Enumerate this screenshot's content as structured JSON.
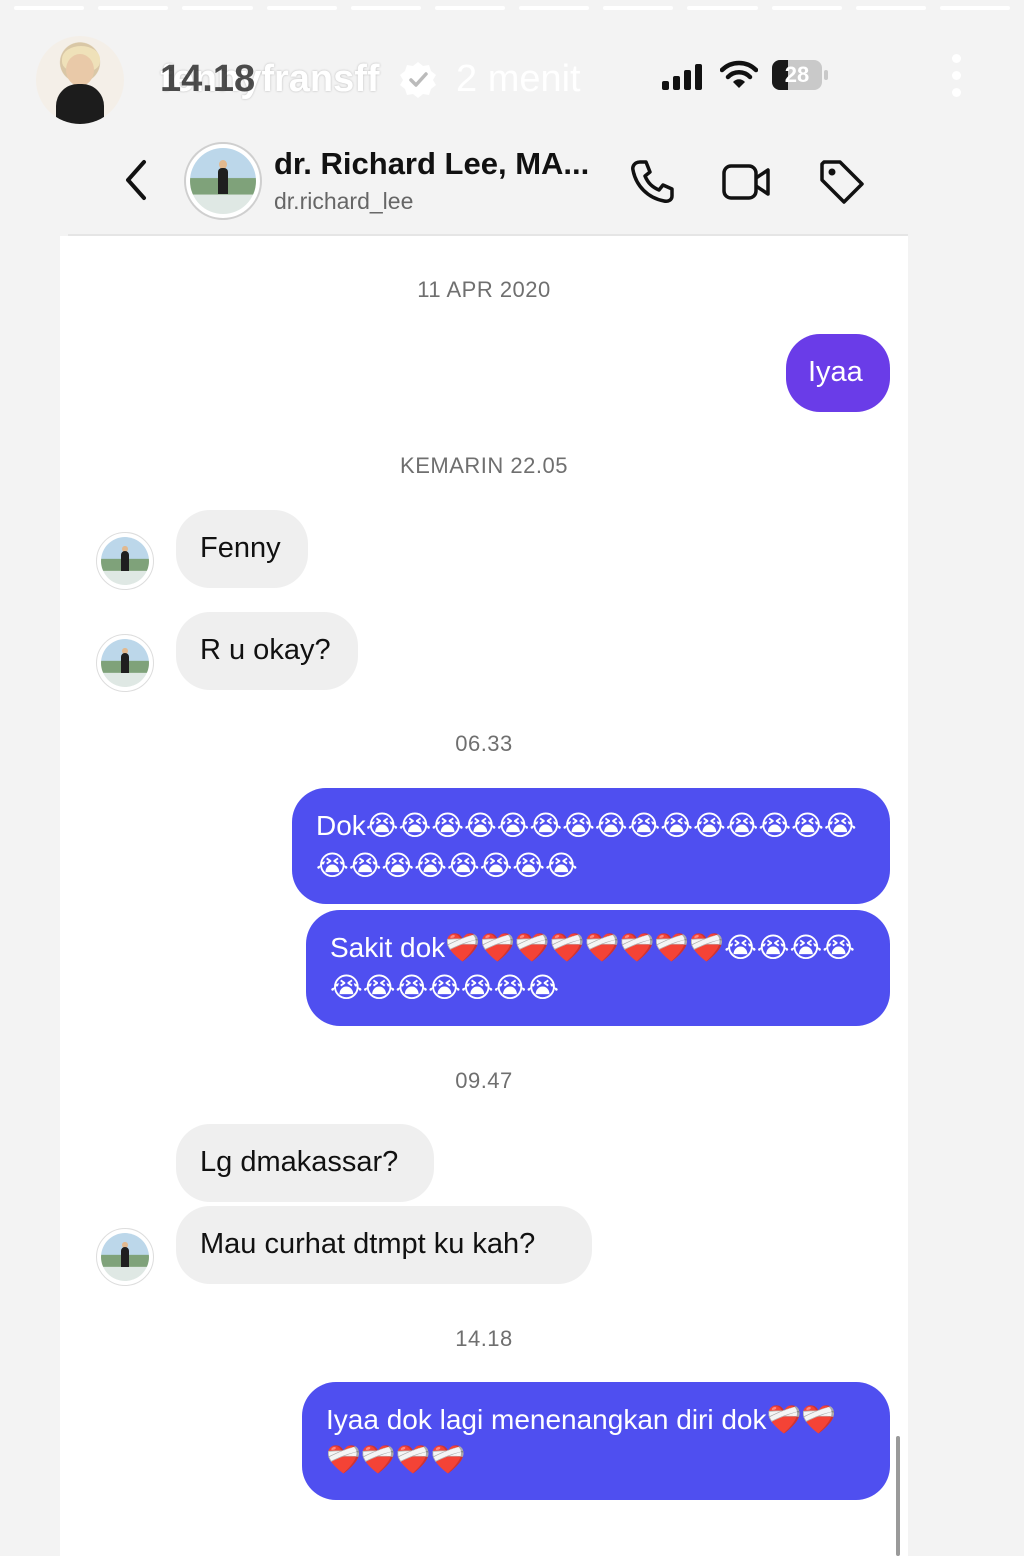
{
  "story": {
    "username": "fennyfransff",
    "time_overlay": "14.18",
    "ago": "2 menit",
    "battery": "28"
  },
  "chat_header": {
    "name": "dr. Richard Lee, MA...",
    "handle": "dr.richard_lee"
  },
  "messages": {
    "stamp_1": "11 APR 2020",
    "out_1": "Iyaa",
    "stamp_2": "KEMARIN 22.05",
    "in_1": "Fenny",
    "in_2": "R u okay?",
    "stamp_3": "06.33",
    "out_2": "Dok😭😭😭😭😭😭😭😭😭😭😭😭😭😭😭😭😭😭😭😭😭😭😭",
    "out_3": "Sakit dok❤️‍🩹❤️‍🩹❤️‍🩹❤️‍🩹❤️‍🩹❤️‍🩹❤️‍🩹❤️‍🩹😭😭😭😭😭😭😭😭😭😭😭",
    "stamp_4": "09.47",
    "in_3": "Lg dmakassar?",
    "in_4": "Mau curhat dtmpt ku kah?",
    "stamp_5": "14.18",
    "out_4": "Iyaa dok lagi menenangkan diri dok❤️‍🩹❤️‍🩹❤️‍🩹❤️‍🩹❤️‍🩹❤️‍🩹"
  },
  "colors": {
    "bubble_purple": "#6a3ce8",
    "bubble_blue": "#4f4ff0",
    "bubble_gray": "#efefef"
  }
}
